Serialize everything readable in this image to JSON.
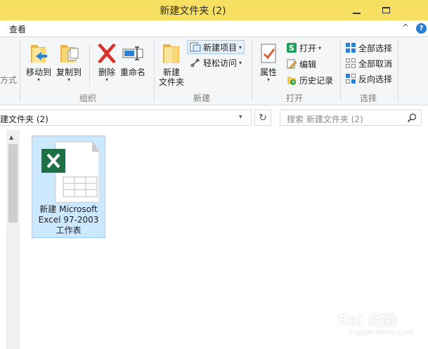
{
  "window": {
    "title": "新建文件夹 (2)"
  },
  "ribbon": {
    "tab_view": "查看",
    "collapse_glyph": "^",
    "help_glyph": "?",
    "partial_left_label": "方式",
    "organize": {
      "label": "组织",
      "move_to": "移动到",
      "copy_to": "复制到",
      "delete": "删除",
      "rename": "重命名"
    },
    "new": {
      "label": "新建",
      "new_folder_line1": "新建",
      "new_folder_line2": "文件夹",
      "new_item": "新建项目",
      "easy_access": "轻松访问"
    },
    "open": {
      "label": "打开",
      "properties": "属性",
      "open": "打开",
      "edit": "编辑",
      "history": "历史记录"
    },
    "select": {
      "label": "选择",
      "select_all": "全部选择",
      "select_none": "全部取消",
      "invert": "反向选择"
    }
  },
  "address": {
    "path": "建文件夹 (2)",
    "search_placeholder": "搜索 新建文件夹 (2)"
  },
  "files": [
    {
      "name_line1": "新建 Microsoft",
      "name_line2": "Excel 97-2003",
      "name_line3": "工作表",
      "icon": "excel-file-icon"
    }
  ],
  "watermark": {
    "text": "Bai 经验",
    "url": "jingyan.baidu.com"
  },
  "colors": {
    "titlebar": "#f7df62",
    "selection": "#cce8ff",
    "excel_green": "#1e7145"
  }
}
